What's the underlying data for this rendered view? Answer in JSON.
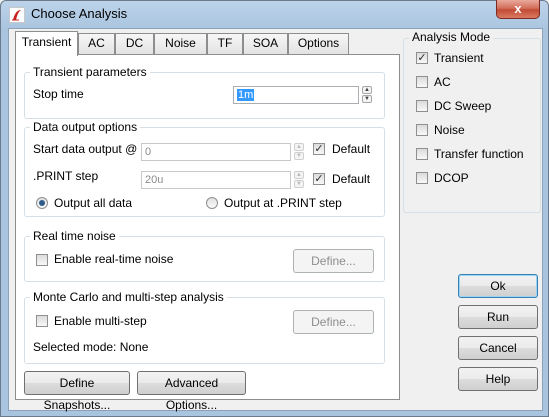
{
  "window": {
    "title": "Choose Analysis",
    "close_glyph": "x"
  },
  "tabs": [
    {
      "label": "Transient",
      "active": true
    },
    {
      "label": "AC",
      "active": false
    },
    {
      "label": "DC",
      "active": false
    },
    {
      "label": "Noise",
      "active": false
    },
    {
      "label": "TF",
      "active": false
    },
    {
      "label": "SOA",
      "active": false
    },
    {
      "label": "Options",
      "active": false
    }
  ],
  "transient_parameters": {
    "title": "Transient parameters",
    "stop_time_label": "Stop time",
    "stop_time_value": "1m"
  },
  "data_output": {
    "title": "Data output options",
    "start_label": "Start data output @",
    "start_value": "0",
    "start_default_label": "Default",
    "start_default_checked": true,
    "print_step_label": ".PRINT step",
    "print_step_value": "20u",
    "print_default_label": "Default",
    "print_default_checked": true,
    "output_all_label": "Output all data",
    "output_all_selected": true,
    "output_print_label": "Output at .PRINT step",
    "output_print_selected": false
  },
  "realtime_noise": {
    "title": "Real time noise",
    "enable_label": "Enable real-time noise",
    "enable_checked": false,
    "define_label": "Define..."
  },
  "monte_carlo": {
    "title": "Monte Carlo and multi-step analysis",
    "enable_label": "Enable multi-step",
    "enable_checked": false,
    "define_label": "Define...",
    "selected_mode_text": "Selected mode: None"
  },
  "bottom_buttons": {
    "snapshots": "Define Snapshots...",
    "advanced": "Advanced Options..."
  },
  "analysis_mode": {
    "title": "Analysis Mode",
    "items": [
      {
        "label": "Transient",
        "checked": true
      },
      {
        "label": "AC",
        "checked": false
      },
      {
        "label": "DC Sweep",
        "checked": false
      },
      {
        "label": "Noise",
        "checked": false
      },
      {
        "label": "Transfer function",
        "checked": false
      },
      {
        "label": "DCOP",
        "checked": false
      }
    ]
  },
  "actions": {
    "ok": "Ok",
    "run": "Run",
    "cancel": "Cancel",
    "help": "Help"
  },
  "glyphs": {
    "check": "✓",
    "spin_up": "▲",
    "spin_down": "▼"
  }
}
